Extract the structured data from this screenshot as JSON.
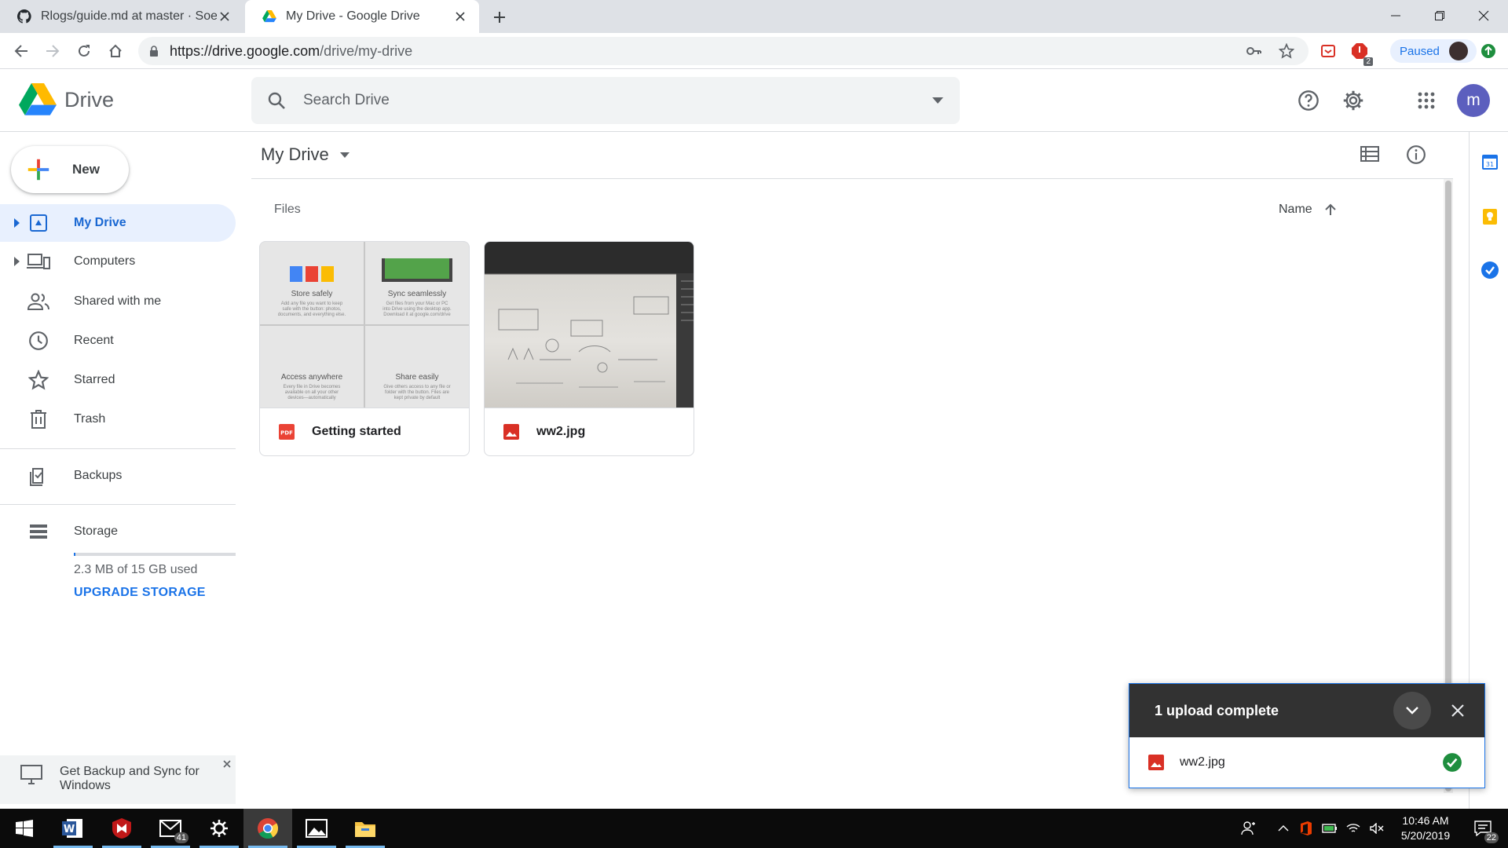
{
  "browser": {
    "tabs": [
      {
        "title": "Rlogs/guide.md at master · Soeu",
        "active": false
      },
      {
        "title": "My Drive - Google Drive",
        "active": true
      }
    ],
    "url_host": "https://drive.google.com",
    "url_path": "/drive/my-drive",
    "profile_status": "Paused",
    "extension_badge": "2"
  },
  "header": {
    "app_name": "Drive",
    "search_placeholder": "Search Drive",
    "avatar_letter": "m"
  },
  "sidebar": {
    "new_label": "New",
    "items": [
      {
        "label": "My Drive",
        "icon": "my-drive-icon",
        "active": true
      },
      {
        "label": "Computers",
        "icon": "computers-icon"
      },
      {
        "label": "Shared with me",
        "icon": "shared-icon"
      },
      {
        "label": "Recent",
        "icon": "clock-icon"
      },
      {
        "label": "Starred",
        "icon": "star-icon"
      },
      {
        "label": "Trash",
        "icon": "trash-icon"
      },
      {
        "label": "Backups",
        "icon": "backups-icon"
      },
      {
        "label": "Storage",
        "icon": "storage-icon"
      }
    ],
    "storage_used_text": "2.3 MB of 15 GB used",
    "storage_fraction": 0.00015,
    "upgrade_label": "UPGRADE STORAGE",
    "promo_text": "Get Backup and Sync for Windows"
  },
  "main": {
    "title": "My Drive",
    "section_label": "Files",
    "sort_label": "Name",
    "files": [
      {
        "name": "Getting started",
        "type_icon": "pdf-icon",
        "thumb_cells": [
          {
            "title": "Store safely",
            "text": "Add any file you want to keep safe with the button: photos, documents, and everything else."
          },
          {
            "title": "Sync seamlessly",
            "text": "Get files from your Mac or PC into Drive using the desktop app. Download it at google.com/drive"
          },
          {
            "title": "Access anywhere",
            "text": "Every file in Drive becomes available on all your other devices—automatically"
          },
          {
            "title": "Share easily",
            "text": "Give others access to any file or folder with the button. Files are kept private by default"
          }
        ]
      },
      {
        "name": "ww2.jpg",
        "type_icon": "image-icon"
      }
    ]
  },
  "upload_toast": {
    "title": "1 upload complete",
    "items": [
      {
        "name": "ww2.jpg",
        "status": "complete"
      }
    ]
  },
  "taskbar": {
    "time": "10:46 AM",
    "date": "5/20/2019",
    "mail_badge": "41",
    "notifications_badge": "22"
  },
  "colors": {
    "accent": "#1a73e8",
    "active_nav_bg": "#e8f0fe",
    "toast_header": "#323232",
    "success": "#1e8e3e"
  }
}
